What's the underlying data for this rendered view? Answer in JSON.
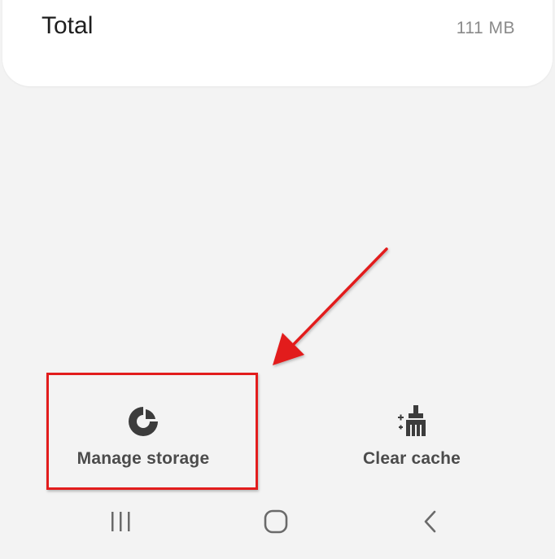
{
  "storage": {
    "total_label": "Total",
    "total_value": "111 MB"
  },
  "actions": {
    "manage_storage": "Manage storage",
    "clear_cache": "Clear cache"
  },
  "icons": {
    "manage_storage": "pie-chart-icon",
    "clear_cache": "brush-sparkle-icon",
    "nav_recent": "recent-apps-icon",
    "nav_home": "home-icon",
    "nav_back": "back-chevron-icon"
  },
  "colors": {
    "annotation": "#e21c1c",
    "background": "#f3f3f3",
    "card": "#ffffff",
    "icon": "#3c3c3c"
  }
}
